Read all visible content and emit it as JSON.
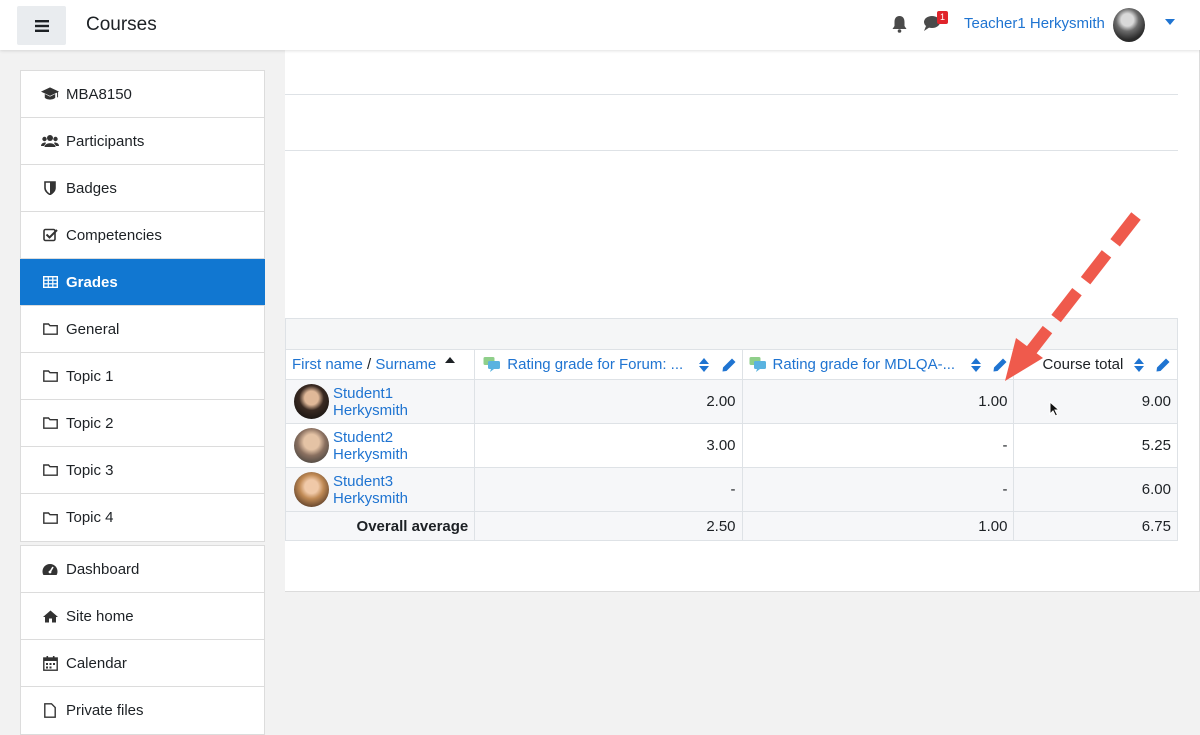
{
  "navbar": {
    "brand": "Courses",
    "notification_count": "1",
    "user_name": "Teacher1 Herkysmith"
  },
  "sidebar": {
    "course_items": [
      {
        "label": "MBA8150",
        "icon": "graduation-cap-icon"
      },
      {
        "label": "Participants",
        "icon": "users-icon"
      },
      {
        "label": "Badges",
        "icon": "shield-icon"
      },
      {
        "label": "Competencies",
        "icon": "check-square-icon"
      },
      {
        "label": "Grades",
        "icon": "table-icon",
        "active": true
      },
      {
        "label": "General",
        "icon": "folder-icon"
      },
      {
        "label": "Topic 1",
        "icon": "folder-icon"
      },
      {
        "label": "Topic 2",
        "icon": "folder-icon"
      },
      {
        "label": "Topic 3",
        "icon": "folder-icon"
      },
      {
        "label": "Topic 4",
        "icon": "folder-icon"
      }
    ],
    "site_items": [
      {
        "label": "Dashboard",
        "icon": "tachometer-icon"
      },
      {
        "label": "Site home",
        "icon": "home-icon"
      },
      {
        "label": "Calendar",
        "icon": "calendar-icon"
      },
      {
        "label": "Private files",
        "icon": "file-icon"
      }
    ]
  },
  "grades_table": {
    "header": {
      "first_name": "First name",
      "separator": " / ",
      "surname": "Surname",
      "col1": "Rating grade for Forum: ...",
      "col2": "Rating grade for MDLQA-...",
      "col3": "Course total"
    },
    "rows": [
      {
        "name": "Student1 Herkysmith",
        "c1": "2.00",
        "c2": "1.00",
        "c3": "9.00"
      },
      {
        "name": "Student2 Herkysmith",
        "c1": "3.00",
        "c2": "-",
        "c3": "5.25"
      },
      {
        "name": "Student3 Herkysmith",
        "c1": "-",
        "c2": "-",
        "c3": "6.00"
      }
    ],
    "average": {
      "label": "Overall average",
      "c1": "2.50",
      "c2": "1.00",
      "c3": "6.75"
    }
  },
  "colors": {
    "accent": "#1177d1",
    "link": "#1f74d1",
    "annotation_arrow": "#ef5a4c"
  }
}
